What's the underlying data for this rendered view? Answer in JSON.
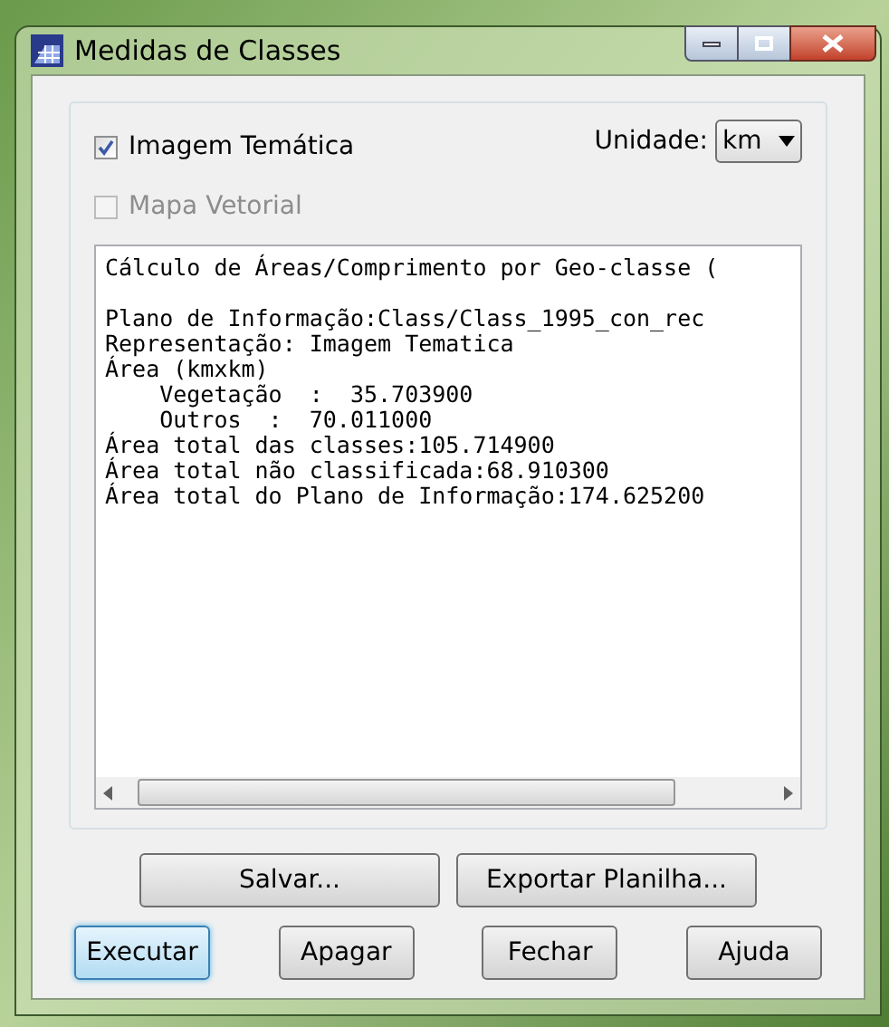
{
  "window": {
    "title": "Medidas de Classes"
  },
  "options": [
    {
      "label": "Imagem Temática",
      "checked": true,
      "disabled": false
    },
    {
      "label": "Mapa Vetorial",
      "checked": false,
      "disabled": true
    }
  ],
  "unit": {
    "label": "Unidade:",
    "value": "km"
  },
  "report": {
    "heading": "Cálculo de Áreas/Comprimento por Geo-classe (",
    "lines": [
      "Plano de Informação:Class/Class_1995_con_rec",
      "Representação: Imagem Tematica",
      "Área (kmxkm)",
      "    Vegetação  :  35.703900",
      "    Outros  :  70.011000",
      "Área total das classes:105.714900",
      "Área total não classificada:68.910300",
      "Área total do Plano de Informação:174.625200"
    ]
  },
  "buttons_row_1": [
    {
      "label": "Salvar...",
      "focused": false
    },
    {
      "label": "Exportar Planilha...",
      "focused": false
    }
  ],
  "buttons_row_2": [
    {
      "label": "Executar",
      "focused": true
    },
    {
      "label": "Apagar",
      "focused": false
    },
    {
      "label": "Fechar",
      "focused": false
    },
    {
      "label": "Ajuda",
      "focused": false
    }
  ]
}
